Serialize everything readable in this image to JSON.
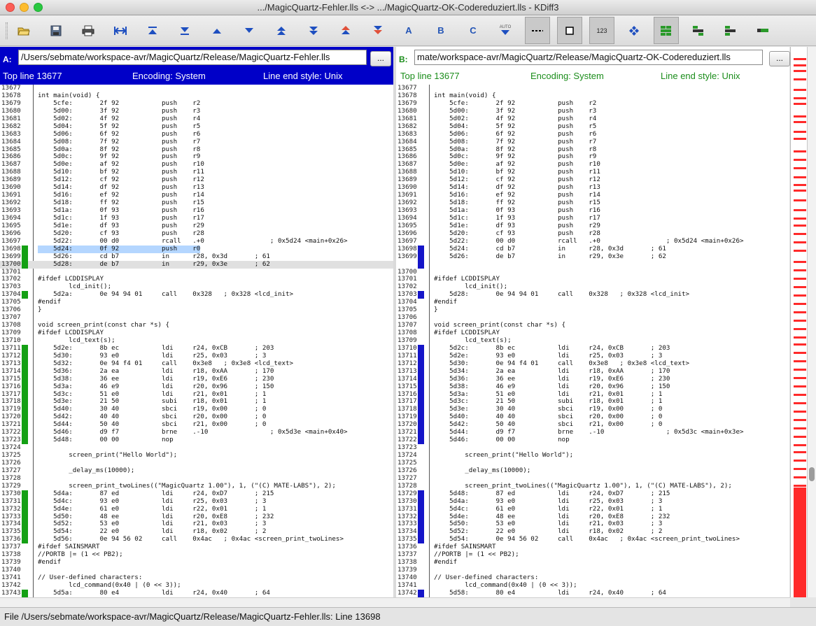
{
  "window": {
    "title": ".../MagicQuartz-Fehler.lls <-> .../MagicQuartz-OK-Codereduziert.lls - KDiff3"
  },
  "toolbar": {
    "auto_label": "AUTO",
    "letter_a": "A",
    "letter_b": "B",
    "letter_c": "C",
    "num_label": "123"
  },
  "pane_a": {
    "label": "A:",
    "path": "/Users/sebmate/workspace-avr/MagicQuartz/Release/MagicQuartz-Fehler.lls",
    "browse": "...",
    "top_line": "Top line 13677",
    "encoding": "Encoding: System",
    "line_end": "Line end style: Unix",
    "lines": [
      {
        "n": "13677",
        "t": "",
        "m": 0
      },
      {
        "n": "13678",
        "t": "int main(void) {",
        "m": 0
      },
      {
        "n": "13679",
        "t": "    5cfe:       2f 92           push    r2",
        "m": 0
      },
      {
        "n": "13680",
        "t": "    5d00:       3f 92           push    r3",
        "m": 0
      },
      {
        "n": "13681",
        "t": "    5d02:       4f 92           push    r4",
        "m": 0
      },
      {
        "n": "13682",
        "t": "    5d04:       5f 92           push    r5",
        "m": 0
      },
      {
        "n": "13683",
        "t": "    5d06:       6f 92           push    r6",
        "m": 0
      },
      {
        "n": "13684",
        "t": "    5d08:       7f 92           push    r7",
        "m": 0
      },
      {
        "n": "13685",
        "t": "    5d0a:       8f 92           push    r8",
        "m": 0
      },
      {
        "n": "13686",
        "t": "    5d0c:       9f 92           push    r9",
        "m": 0
      },
      {
        "n": "13687",
        "t": "    5d0e:       af 92           push    r10",
        "m": 0
      },
      {
        "n": "13688",
        "t": "    5d10:       bf 92           push    r11",
        "m": 0
      },
      {
        "n": "13689",
        "t": "    5d12:       cf 92           push    r12",
        "m": 0
      },
      {
        "n": "13690",
        "t": "    5d14:       df 92           push    r13",
        "m": 0
      },
      {
        "n": "13691",
        "t": "    5d16:       ef 92           push    r14",
        "m": 0
      },
      {
        "n": "13692",
        "t": "    5d18:       ff 92           push    r15",
        "m": 0
      },
      {
        "n": "13693",
        "t": "    5d1a:       0f 93           push    r16",
        "m": 0
      },
      {
        "n": "13694",
        "t": "    5d1c:       1f 93           push    r17",
        "m": 0
      },
      {
        "n": "13695",
        "t": "    5d1e:       df 93           push    r29",
        "m": 0
      },
      {
        "n": "13696",
        "t": "    5d20:       cf 93           push    r28",
        "m": 0
      },
      {
        "n": "13697",
        "t": "    5d22:       00 d0           rcall   .+0                 ; 0x5d24 <main+0x26>",
        "m": 0
      },
      {
        "n": "13698",
        "t": "    5d24:       0f 92           push    r0",
        "m": 1,
        "c": "sel"
      },
      {
        "n": "13699",
        "t": "    5d26:       cd b7           in      r28, 0x3d       ; 61",
        "m": 1
      },
      {
        "n": "13700",
        "t": "    5d28:       de b7           in      r29, 0x3e       ; 62",
        "m": 1,
        "c": "gl"
      },
      {
        "n": "13701",
        "t": "",
        "m": 0
      },
      {
        "n": "13702",
        "t": "#ifdef LCDDISPLAY",
        "m": 0
      },
      {
        "n": "13703",
        "t": "        lcd_init();",
        "m": 0
      },
      {
        "n": "13704",
        "t": "    5d2a:       0e 94 94 01     call    0x328   ; 0x328 <lcd_init>",
        "m": 1
      },
      {
        "n": "13705",
        "t": "#endif",
        "m": 0
      },
      {
        "n": "13706",
        "t": "}",
        "m": 0
      },
      {
        "n": "13707",
        "t": "",
        "m": 0
      },
      {
        "n": "13708",
        "t": "void screen_print(const char *s) {",
        "m": 0
      },
      {
        "n": "13709",
        "t": "#ifdef LCDDISPLAY",
        "m": 0
      },
      {
        "n": "13710",
        "t": "        lcd_text(s);",
        "m": 0
      },
      {
        "n": "13711",
        "t": "    5d2e:       8b ec           ldi     r24, 0xCB       ; 203",
        "m": 1
      },
      {
        "n": "13712",
        "t": "    5d30:       93 e0           ldi     r25, 0x03       ; 3",
        "m": 1
      },
      {
        "n": "13713",
        "t": "    5d32:       0e 94 f4 01     call    0x3e8   ; 0x3e8 <lcd_text>",
        "m": 1
      },
      {
        "n": "13714",
        "t": "    5d36:       2a ea           ldi     r18, 0xAA       ; 170",
        "m": 1
      },
      {
        "n": "13715",
        "t": "    5d38:       36 ee           ldi     r19, 0xE6       ; 230",
        "m": 1
      },
      {
        "n": "13716",
        "t": "    5d3a:       46 e9           ldi     r20, 0x96       ; 150",
        "m": 1
      },
      {
        "n": "13717",
        "t": "    5d3c:       51 e0           ldi     r21, 0x01       ; 1",
        "m": 1
      },
      {
        "n": "13718",
        "t": "    5d3e:       21 50           subi    r18, 0x01       ; 1",
        "m": 1
      },
      {
        "n": "13719",
        "t": "    5d40:       30 40           sbci    r19, 0x00       ; 0",
        "m": 1
      },
      {
        "n": "13720",
        "t": "    5d42:       40 40           sbci    r20, 0x00       ; 0",
        "m": 1
      },
      {
        "n": "13721",
        "t": "    5d44:       50 40           sbci    r21, 0x00       ; 0",
        "m": 1
      },
      {
        "n": "13722",
        "t": "    5d46:       d9 f7           brne    .-10                ; 0x5d3e <main+0x40>",
        "m": 1
      },
      {
        "n": "13723",
        "t": "    5d48:       00 00           nop",
        "m": 1
      },
      {
        "n": "13724",
        "t": "",
        "m": 0
      },
      {
        "n": "13725",
        "t": "        screen_print(\"Hello World\");",
        "m": 0
      },
      {
        "n": "13726",
        "t": "",
        "m": 0
      },
      {
        "n": "13727",
        "t": "        _delay_ms(10000);",
        "m": 0
      },
      {
        "n": "13728",
        "t": "",
        "m": 0
      },
      {
        "n": "13729",
        "t": "        screen_print_twoLines((\"MagicQuartz 1.00\"), 1, (\"(C) MATE-LABS\"), 2);",
        "m": 0
      },
      {
        "n": "13730",
        "t": "    5d4a:       87 ed           ldi     r24, 0xD7       ; 215",
        "m": 1
      },
      {
        "n": "13731",
        "t": "    5d4c:       93 e0           ldi     r25, 0x03       ; 3",
        "m": 1
      },
      {
        "n": "13732",
        "t": "    5d4e:       61 e0           ldi     r22, 0x01       ; 1",
        "m": 1
      },
      {
        "n": "13733",
        "t": "    5d50:       48 ee           ldi     r20, 0xE8       ; 232",
        "m": 1
      },
      {
        "n": "13734",
        "t": "    5d52:       53 e0           ldi     r21, 0x03       ; 3",
        "m": 1
      },
      {
        "n": "13735",
        "t": "    5d54:       22 e0           ldi     r18, 0x02       ; 2",
        "m": 1
      },
      {
        "n": "13736",
        "t": "    5d56:       0e 94 56 02     call    0x4ac   ; 0x4ac <screen_print_twoLines>",
        "m": 1
      },
      {
        "n": "13737",
        "t": "#ifdef SAINSMART",
        "m": 0
      },
      {
        "n": "13738",
        "t": "//PORTB |= (1 << PB2);",
        "m": 0
      },
      {
        "n": "13739",
        "t": "#endif",
        "m": 0
      },
      {
        "n": "13740",
        "t": "",
        "m": 0
      },
      {
        "n": "13741",
        "t": "// User-defined characters:",
        "m": 0
      },
      {
        "n": "13742",
        "t": "        lcd_command(0x40 | (0 << 3));",
        "m": 0
      },
      {
        "n": "13743",
        "t": "    5d5a:       80 e4           ldi     r24, 0x40       ; 64",
        "m": 1
      }
    ]
  },
  "pane_b": {
    "label": "B:",
    "path": "mate/workspace-avr/MagicQuartz/Release/MagicQuartz-OK-Codereduziert.lls",
    "browse": "...",
    "top_line": "Top line 13677",
    "encoding": "Encoding: System",
    "line_end": "Line end style: Unix",
    "lines": [
      {
        "n": "13677",
        "t": "",
        "m": 0
      },
      {
        "n": "13678",
        "t": "int main(void) {",
        "m": 0
      },
      {
        "n": "13679",
        "t": "    5cfe:       2f 92           push    r2",
        "m": 0
      },
      {
        "n": "13680",
        "t": "    5d00:       3f 92           push    r3",
        "m": 0
      },
      {
        "n": "13681",
        "t": "    5d02:       4f 92           push    r4",
        "m": 0
      },
      {
        "n": "13682",
        "t": "    5d04:       5f 92           push    r5",
        "m": 0
      },
      {
        "n": "13683",
        "t": "    5d06:       6f 92           push    r6",
        "m": 0
      },
      {
        "n": "13684",
        "t": "    5d08:       7f 92           push    r7",
        "m": 0
      },
      {
        "n": "13685",
        "t": "    5d0a:       8f 92           push    r8",
        "m": 0
      },
      {
        "n": "13686",
        "t": "    5d0c:       9f 92           push    r9",
        "m": 0
      },
      {
        "n": "13687",
        "t": "    5d0e:       af 92           push    r10",
        "m": 0
      },
      {
        "n": "13688",
        "t": "    5d10:       bf 92           push    r11",
        "m": 0
      },
      {
        "n": "13689",
        "t": "    5d12:       cf 92           push    r12",
        "m": 0
      },
      {
        "n": "13690",
        "t": "    5d14:       df 92           push    r13",
        "m": 0
      },
      {
        "n": "13691",
        "t": "    5d16:       ef 92           push    r14",
        "m": 0
      },
      {
        "n": "13692",
        "t": "    5d18:       ff 92           push    r15",
        "m": 0
      },
      {
        "n": "13693",
        "t": "    5d1a:       0f 93           push    r16",
        "m": 0
      },
      {
        "n": "13694",
        "t": "    5d1c:       1f 93           push    r17",
        "m": 0
      },
      {
        "n": "13695",
        "t": "    5d1e:       df 93           push    r29",
        "m": 0
      },
      {
        "n": "13696",
        "t": "    5d20:       cf 93           push    r28",
        "m": 0
      },
      {
        "n": "13697",
        "t": "    5d22:       00 d0           rcall   .+0                 ; 0x5d24 <main+0x26>",
        "m": 0
      },
      {
        "n": "13698",
        "t": "    5d24:       cd b7           in      r28, 0x3d       ; 61",
        "m": 1
      },
      {
        "n": "13699",
        "t": "    5d26:       de b7           in      r29, 0x3e       ; 62",
        "m": 1
      },
      {
        "n": "",
        "t": "",
        "m": 1
      },
      {
        "n": "13700",
        "t": "",
        "m": 0
      },
      {
        "n": "13701",
        "t": "#ifdef LCDDISPLAY",
        "m": 0
      },
      {
        "n": "13702",
        "t": "        lcd_init();",
        "m": 0
      },
      {
        "n": "13703",
        "t": "    5d28:       0e 94 94 01     call    0x328   ; 0x328 <lcd_init>",
        "m": 1
      },
      {
        "n": "13704",
        "t": "#endif",
        "m": 0
      },
      {
        "n": "13705",
        "t": "}",
        "m": 0
      },
      {
        "n": "13706",
        "t": "",
        "m": 0
      },
      {
        "n": "13707",
        "t": "void screen_print(const char *s) {",
        "m": 0
      },
      {
        "n": "13708",
        "t": "#ifdef LCDDISPLAY",
        "m": 0
      },
      {
        "n": "13709",
        "t": "        lcd_text(s);",
        "m": 0
      },
      {
        "n": "13710",
        "t": "    5d2c:       8b ec           ldi     r24, 0xCB       ; 203",
        "m": 1
      },
      {
        "n": "13711",
        "t": "    5d2e:       93 e0           ldi     r25, 0x03       ; 3",
        "m": 1
      },
      {
        "n": "13712",
        "t": "    5d30:       0e 94 f4 01     call    0x3e8   ; 0x3e8 <lcd_text>",
        "m": 1
      },
      {
        "n": "13713",
        "t": "    5d34:       2a ea           ldi     r18, 0xAA       ; 170",
        "m": 1
      },
      {
        "n": "13714",
        "t": "    5d36:       36 ee           ldi     r19, 0xE6       ; 230",
        "m": 1
      },
      {
        "n": "13715",
        "t": "    5d38:       46 e9           ldi     r20, 0x96       ; 150",
        "m": 1
      },
      {
        "n": "13716",
        "t": "    5d3a:       51 e0           ldi     r21, 0x01       ; 1",
        "m": 1
      },
      {
        "n": "13717",
        "t": "    5d3c:       21 50           subi    r18, 0x01       ; 1",
        "m": 1
      },
      {
        "n": "13718",
        "t": "    5d3e:       30 40           sbci    r19, 0x00       ; 0",
        "m": 1
      },
      {
        "n": "13719",
        "t": "    5d40:       40 40           sbci    r20, 0x00       ; 0",
        "m": 1
      },
      {
        "n": "13720",
        "t": "    5d42:       50 40           sbci    r21, 0x00       ; 0",
        "m": 1
      },
      {
        "n": "13721",
        "t": "    5d44:       d9 f7           brne    .-10                ; 0x5d3c <main+0x3e>",
        "m": 1
      },
      {
        "n": "13722",
        "t": "    5d46:       00 00           nop",
        "m": 1
      },
      {
        "n": "13723",
        "t": "",
        "m": 0
      },
      {
        "n": "13724",
        "t": "        screen_print(\"Hello World\");",
        "m": 0
      },
      {
        "n": "13725",
        "t": "",
        "m": 0
      },
      {
        "n": "13726",
        "t": "        _delay_ms(10000);",
        "m": 0
      },
      {
        "n": "13727",
        "t": "",
        "m": 0
      },
      {
        "n": "13728",
        "t": "        screen_print_twoLines((\"MagicQuartz 1.00\"), 1, (\"(C) MATE-LABS\"), 2);",
        "m": 0
      },
      {
        "n": "13729",
        "t": "    5d48:       87 ed           ldi     r24, 0xD7       ; 215",
        "m": 1
      },
      {
        "n": "13730",
        "t": "    5d4a:       93 e0           ldi     r25, 0x03       ; 3",
        "m": 1
      },
      {
        "n": "13731",
        "t": "    5d4c:       61 e0           ldi     r22, 0x01       ; 1",
        "m": 1
      },
      {
        "n": "13732",
        "t": "    5d4e:       48 ee           ldi     r20, 0xE8       ; 232",
        "m": 1
      },
      {
        "n": "13733",
        "t": "    5d50:       53 e0           ldi     r21, 0x03       ; 3",
        "m": 1
      },
      {
        "n": "13734",
        "t": "    5d52:       22 e0           ldi     r18, 0x02       ; 2",
        "m": 1
      },
      {
        "n": "13735",
        "t": "    5d54:       0e 94 56 02     call    0x4ac   ; 0x4ac <screen_print_twoLines>",
        "m": 1
      },
      {
        "n": "13736",
        "t": "#ifdef SAINSMART",
        "m": 0
      },
      {
        "n": "13737",
        "t": "//PORTB |= (1 << PB2);",
        "m": 0
      },
      {
        "n": "13738",
        "t": "#endif",
        "m": 0
      },
      {
        "n": "13739",
        "t": "",
        "m": 0
      },
      {
        "n": "13740",
        "t": "// User-defined characters:",
        "m": 0
      },
      {
        "n": "13741",
        "t": "        lcd_command(0x40 | (0 << 3));",
        "m": 0
      },
      {
        "n": "13742",
        "t": "    5d58:       80 e4           ldi     r24, 0x40       ; 64",
        "m": 1
      }
    ]
  },
  "status": {
    "text": "File /Users/sebmate/workspace-avr/MagicQuartz/Release/MagicQuartz-Fehler.lls: Line 13698"
  },
  "colors": {
    "diff_a": "#14a014",
    "diff_b": "#1515c8",
    "overview": "#ff2a2a",
    "header_a": "#0000c8",
    "header_b_text": "#1b8d1b"
  }
}
